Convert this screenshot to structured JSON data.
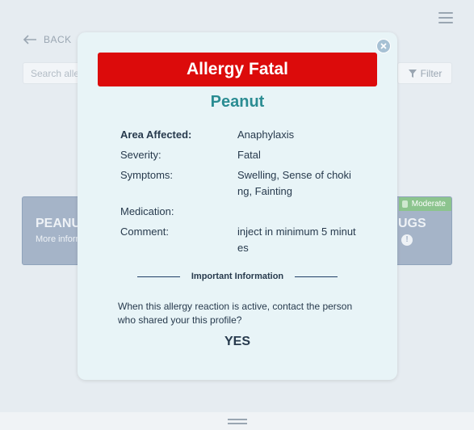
{
  "header": {
    "back_label": "BACK",
    "menu_icon": "hamburger-menu-icon"
  },
  "search": {
    "placeholder": "Search aller"
  },
  "filter": {
    "label": "Filter"
  },
  "cards": [
    {
      "title": "PEANU",
      "subtitle": "More inform"
    },
    {
      "title": "UGS",
      "badge": "Moderate"
    }
  ],
  "modal": {
    "alert_title": "Allergy Fatal",
    "allergen": "Peanut",
    "details": [
      {
        "label": "Area Affected:",
        "value": "Anaphylaxis"
      },
      {
        "label": "Severity:",
        "value": "Fatal"
      },
      {
        "label": "Symptoms:",
        "value": "Swelling, Sense of choking, Fainting"
      },
      {
        "label": "Medication:",
        "value": ""
      },
      {
        "label": "Comment:",
        "value": "inject in minimum 5 minutes"
      }
    ],
    "divider_label": "Important Information",
    "question": "When this allergy reaction is active, contact the person who shared your this profile?",
    "yes_label": "YES"
  },
  "colors": {
    "alert_red": "#dc0b0b",
    "allergen_teal": "#2a8c92",
    "modal_bg": "#e8f4f7",
    "badge_green": "#8cc48e"
  }
}
